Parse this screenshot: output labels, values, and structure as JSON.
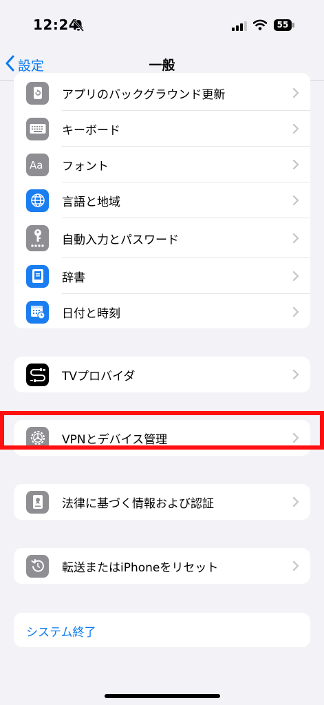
{
  "status_bar": {
    "time": "12:24",
    "battery": "55"
  },
  "nav": {
    "back_label": "設定",
    "title": "一般"
  },
  "group1": [
    {
      "label": "アプリのバックグラウンド更新",
      "icon": "background-refresh-icon",
      "color": "#8e8e93"
    },
    {
      "label": "キーボード",
      "icon": "keyboard-icon",
      "color": "#8e8e93"
    },
    {
      "label": "フォント",
      "icon": "font-icon",
      "color": "#8e8e93"
    },
    {
      "label": "言語と地域",
      "icon": "globe-icon",
      "color": "#1a7df0"
    },
    {
      "label": "自動入力とパスワード",
      "icon": "key-icon",
      "color": "#8e8e93"
    },
    {
      "label": "辞書",
      "icon": "dictionary-icon",
      "color": "#1a7df0"
    },
    {
      "label": "日付と時刻",
      "icon": "calendar-clock-icon",
      "color": "#1a7df0"
    }
  ],
  "group2": [
    {
      "label": "TVプロバイダ",
      "icon": "tv-provider-icon",
      "color": "#000000"
    }
  ],
  "group3": [
    {
      "label": "VPNとデバイス管理",
      "icon": "gear-icon",
      "color": "#8e8e93"
    }
  ],
  "group4": [
    {
      "label": "法律に基づく情報および認証",
      "icon": "legal-icon",
      "color": "#8e8e93"
    }
  ],
  "group5": [
    {
      "label": "転送またはiPhoneをリセット",
      "icon": "reset-icon",
      "color": "#8e8e93"
    }
  ],
  "shutdown": {
    "label": "システム終了"
  },
  "colors": {
    "accent": "#0a7bef",
    "highlight": "#ff1010"
  }
}
